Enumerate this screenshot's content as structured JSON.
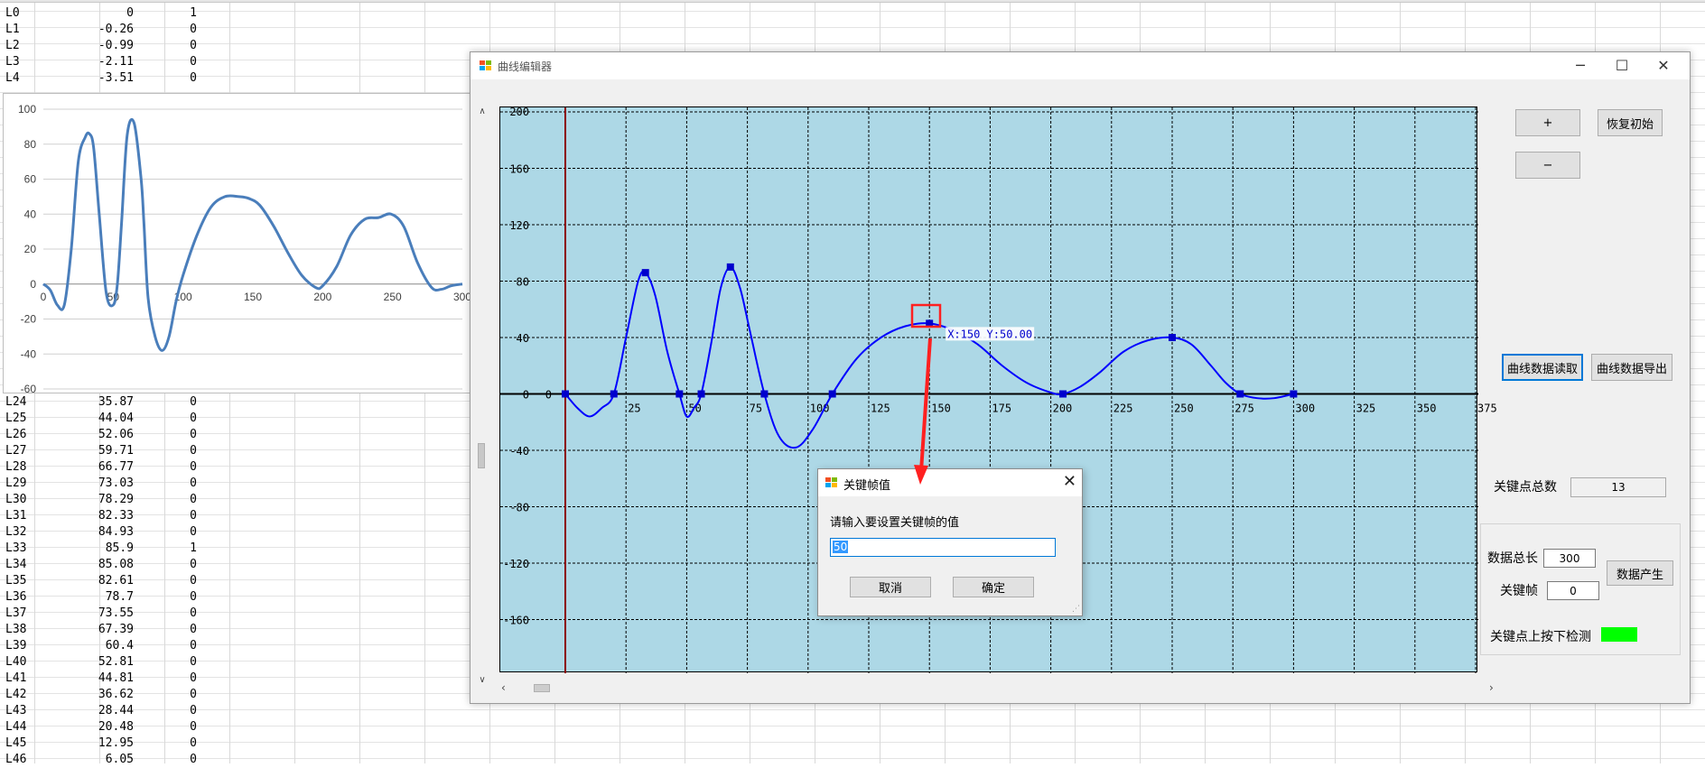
{
  "spreadsheet": {
    "top_rows": [
      {
        "label": "L0",
        "value": "0",
        "flag": "1"
      },
      {
        "label": "L1",
        "value": "-0.26",
        "flag": "0"
      },
      {
        "label": "L2",
        "value": "-0.99",
        "flag": "0"
      },
      {
        "label": "L3",
        "value": "-2.11",
        "flag": "0"
      },
      {
        "label": "L4",
        "value": "-3.51",
        "flag": "0"
      }
    ],
    "bottom_rows": [
      {
        "label": "L24",
        "value": "35.87",
        "flag": "0"
      },
      {
        "label": "L25",
        "value": "44.04",
        "flag": "0"
      },
      {
        "label": "L26",
        "value": "52.06",
        "flag": "0"
      },
      {
        "label": "L27",
        "value": "59.71",
        "flag": "0"
      },
      {
        "label": "L28",
        "value": "66.77",
        "flag": "0"
      },
      {
        "label": "L29",
        "value": "73.03",
        "flag": "0"
      },
      {
        "label": "L30",
        "value": "78.29",
        "flag": "0"
      },
      {
        "label": "L31",
        "value": "82.33",
        "flag": "0"
      },
      {
        "label": "L32",
        "value": "84.93",
        "flag": "0"
      },
      {
        "label": "L33",
        "value": "85.9",
        "flag": "1"
      },
      {
        "label": "L34",
        "value": "85.08",
        "flag": "0"
      },
      {
        "label": "L35",
        "value": "82.61",
        "flag": "0"
      },
      {
        "label": "L36",
        "value": "78.7",
        "flag": "0"
      },
      {
        "label": "L37",
        "value": "73.55",
        "flag": "0"
      },
      {
        "label": "L38",
        "value": "67.39",
        "flag": "0"
      },
      {
        "label": "L39",
        "value": "60.4",
        "flag": "0"
      },
      {
        "label": "L40",
        "value": "52.81",
        "flag": "0"
      },
      {
        "label": "L41",
        "value": "44.81",
        "flag": "0"
      },
      {
        "label": "L42",
        "value": "36.62",
        "flag": "0"
      },
      {
        "label": "L43",
        "value": "28.44",
        "flag": "0"
      },
      {
        "label": "L44",
        "value": "20.48",
        "flag": "0"
      },
      {
        "label": "L45",
        "value": "12.95",
        "flag": "0"
      },
      {
        "label": "L46",
        "value": "6.05",
        "flag": "0"
      }
    ]
  },
  "chart_data": [
    {
      "type": "line",
      "title": "",
      "xlabel": "",
      "ylabel": "",
      "xlim": [
        0,
        300
      ],
      "ylim": [
        -60,
        100
      ],
      "x_ticks": [
        "0",
        "50",
        "100",
        "150",
        "200",
        "250",
        "300"
      ],
      "y_ticks": [
        "100",
        "80",
        "60",
        "40",
        "20",
        "0",
        "-20",
        "-40",
        "-60"
      ],
      "grid": "horizontal",
      "color": "#4a7ebb",
      "series": [
        {
          "x": [
            0,
            5,
            10,
            15,
            20,
            25,
            30,
            33,
            36,
            40,
            45,
            50,
            53,
            56,
            60,
            65,
            70,
            72,
            75,
            80,
            85,
            90,
            95,
            100,
            110,
            120,
            130,
            140,
            147,
            155,
            165,
            175,
            185,
            195,
            200,
            210,
            220,
            230,
            240,
            249,
            258,
            268,
            278,
            285,
            292,
            300
          ],
          "y": [
            0,
            -3.5,
            -12,
            -12,
            20,
            70,
            84,
            85.9,
            78,
            40,
            -5,
            -12,
            0,
            35,
            85,
            92,
            60,
            35,
            -8,
            -30,
            -38,
            -30,
            -10,
            5,
            28,
            44,
            50,
            50,
            49,
            45,
            33,
            18,
            5,
            -2,
            -1,
            10,
            28,
            37,
            38,
            40,
            33,
            12,
            -2,
            -3,
            -1,
            0
          ]
        }
      ]
    },
    {
      "type": "line",
      "title": "",
      "xlabel": "",
      "ylabel": "",
      "xlim": [
        0,
        380
      ],
      "ylim": [
        -200,
        200
      ],
      "x_ticks": [
        "25",
        "50",
        "75",
        "100",
        "125",
        "150",
        "175",
        "200",
        "225",
        "250",
        "275",
        "300",
        "325",
        "350",
        "375"
      ],
      "y_ticks": [
        "200",
        "160",
        "120",
        "80",
        "40",
        "0",
        "-40",
        "-80",
        "-120",
        "-160"
      ],
      "color": "#0000ff",
      "background": "#add8e6",
      "keyframes": {
        "x": [
          0,
          20,
          33,
          47,
          56,
          68,
          82,
          110,
          150,
          205,
          250,
          278,
          300
        ],
        "y": [
          0,
          0,
          86,
          0,
          0,
          90,
          0,
          0,
          50,
          0,
          40,
          0,
          0
        ]
      },
      "curve": {
        "x": [
          0,
          5,
          10,
          15,
          20,
          25,
          30,
          33,
          37,
          42,
          47,
          50,
          53,
          56,
          60,
          64,
          68,
          72,
          76,
          82,
          88,
          95,
          102,
          110,
          120,
          130,
          140,
          150,
          160,
          170,
          180,
          190,
          200,
          205,
          212,
          220,
          230,
          240,
          250,
          258,
          266,
          272,
          278,
          285,
          292,
          300
        ],
        "y": [
          0,
          -10,
          -16,
          -10,
          0,
          40,
          80,
          86,
          70,
          30,
          0,
          -16,
          -10,
          0,
          35,
          75,
          90,
          75,
          45,
          0,
          -30,
          -38,
          -25,
          0,
          25,
          40,
          48,
          50,
          45,
          35,
          20,
          8,
          1,
          0,
          5,
          15,
          30,
          38,
          40,
          35,
          20,
          8,
          0,
          -3,
          -3,
          0
        ]
      },
      "tooltip": "X:150 Y:50.00"
    }
  ],
  "editor": {
    "title": "曲线编辑器",
    "window_controls": {
      "minimize": "─",
      "maximize": "☐",
      "close": "✕"
    },
    "buttons": {
      "plus": "+",
      "minus": "−",
      "reset": "恢复初始",
      "read_data": "曲线数据读取",
      "export_data": "曲线数据导出",
      "generate": "数据产生"
    },
    "keypoint_total_label": "关键点总数",
    "keypoint_total_value": "13",
    "data_length_label": "数据总长",
    "data_length_value": "300",
    "keyframe_label": "关键帧",
    "keyframe_value": "0",
    "keypoint_press_label": "关键点上按下检测",
    "led_color": "#00ff00"
  },
  "dialog": {
    "title": "关键帧值",
    "prompt": "请输入要设置关键帧的值",
    "input_value": "50",
    "cancel": "取消",
    "ok": "确定"
  }
}
